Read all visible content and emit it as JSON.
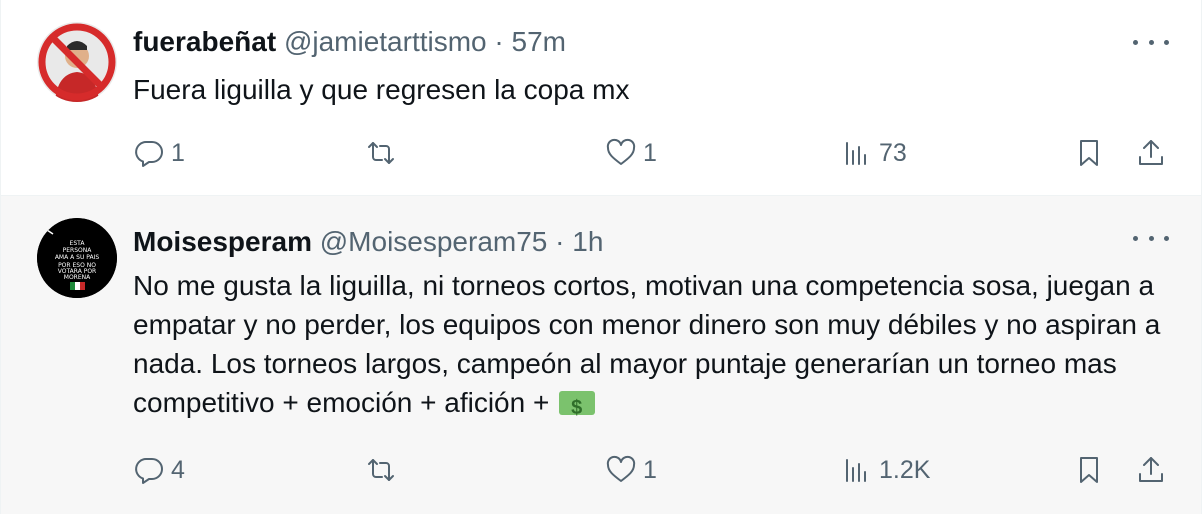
{
  "tweets": [
    {
      "display_name": "fuerabeñat",
      "handle": "@jamietarttismo",
      "separator": "·",
      "time": "57m",
      "text": "Fuera liguilla y que regresen la copa mx",
      "replies": "1",
      "retweets": "",
      "likes": "1",
      "views": "73",
      "avatar_icon": "no-symbol-avatar"
    },
    {
      "display_name": "Moisesperam",
      "handle": "@Moisesperam75",
      "separator": "·",
      "time": "1h",
      "text": "No me gusta la liguilla, ni torneos cortos, motivan una competencia sosa, juegan a empatar y no perder, los equipos con menor dinero son muy débiles y no aspiran a nada. Los torneos largos, campeón al mayor puntaje generarían un torneo mas competitivo + emoción + afición + ",
      "emoji": "money-with-wings",
      "replies": "4",
      "retweets": "",
      "likes": "1",
      "views": "1.2K",
      "avatar_text": {
        "line1": "ESTA",
        "line2": "PERSONA",
        "line3": "AMA A SU PAIS",
        "line4": "POR ESO NO",
        "line5": "VOTARA POR",
        "line6": "MORENA"
      }
    }
  ],
  "colors": {
    "text_primary": "#0f1419",
    "text_secondary": "#536471",
    "reply_background": "#f7f7f7",
    "no_symbol_red": "#d62b2b"
  }
}
